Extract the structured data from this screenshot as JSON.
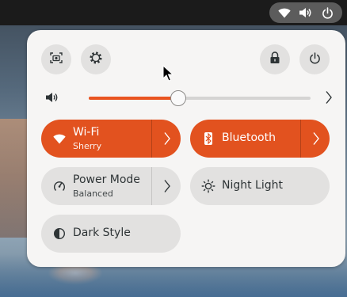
{
  "tray": {
    "icons": [
      "wifi-icon",
      "volume-icon",
      "power-icon"
    ]
  },
  "actions": {
    "icons": [
      "screenshot-icon",
      "settings-icon",
      "lock-icon",
      "power-icon"
    ]
  },
  "volume": {
    "level": 0.4,
    "icon": "volume-icon"
  },
  "toggles": {
    "wifi": {
      "label": "Wi-Fi",
      "subtitle": "Sherry",
      "active": true
    },
    "bluetooth": {
      "label": "Bluetooth",
      "active": true
    },
    "power_mode": {
      "label": "Power Mode",
      "subtitle": "Balanced",
      "active": false
    },
    "night_light": {
      "label": "Night Light",
      "active": false
    },
    "dark_style": {
      "label": "Dark Style",
      "active": false
    }
  },
  "colors": {
    "accent": "#e2521f",
    "panel": "#f6f5f4",
    "button": "#e2e1e0",
    "topbar": "#1b1b1b"
  }
}
